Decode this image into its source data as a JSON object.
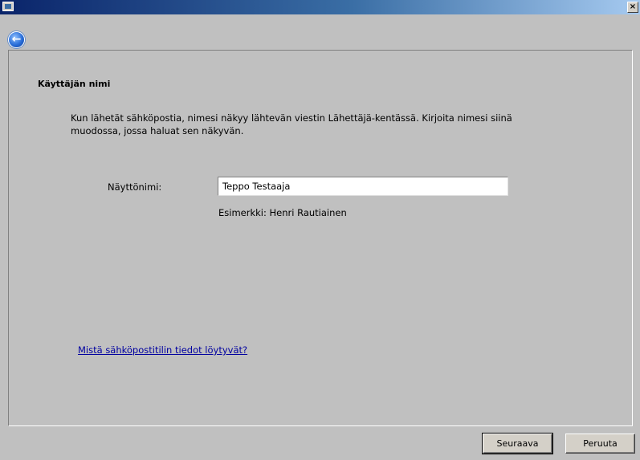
{
  "window": {
    "icon": "window-icon",
    "close_label": "×"
  },
  "toolbar": {
    "back_icon": "back-arrow-icon",
    "back_glyph": "←"
  },
  "page": {
    "title": "Käyttäjän nimi",
    "description": "Kun lähetät sähköpostia, nimesi näkyy lähtevän viestin Lähettäjä-kentässä. Kirjoita nimesi siinä muodossa, jossa haluat sen näkyvän.",
    "display_name_label": "Näyttönimi:",
    "display_name_value": "Teppo Testaaja",
    "example": "Esimerkki: Henri Rautiainen",
    "help_link": "Mistä sähköpostitilin tiedot löytyvät?"
  },
  "footer": {
    "next_label": "Seuraava",
    "cancel_label": "Peruuta"
  }
}
